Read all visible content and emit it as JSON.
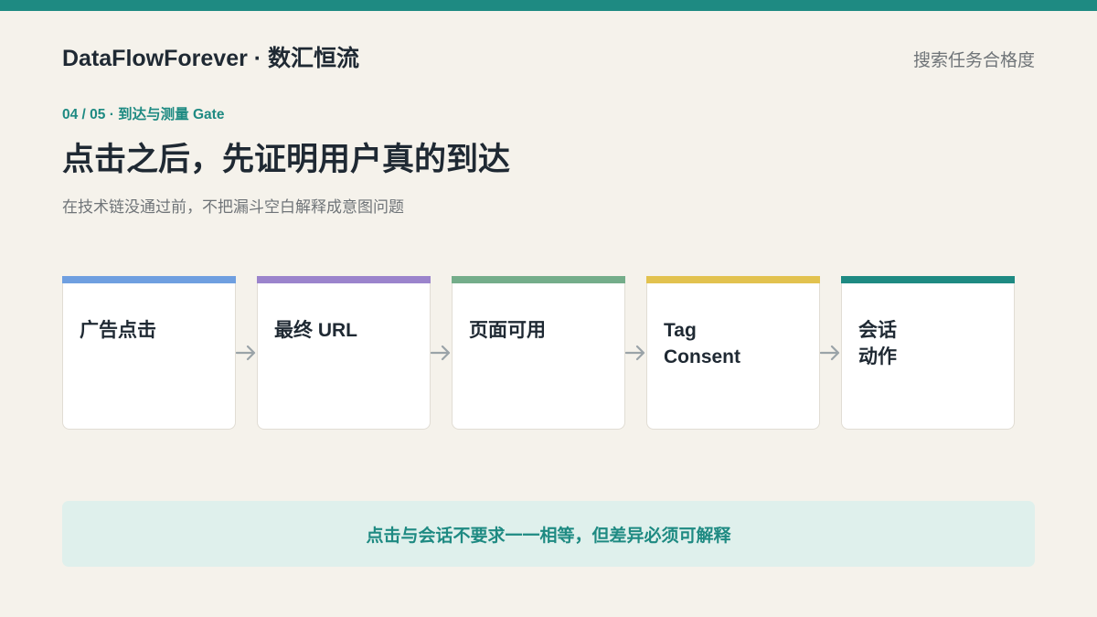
{
  "header": {
    "brand": "DataFlowForever · 数汇恒流",
    "link": "搜索任务合格度"
  },
  "slide": {
    "kicker": "04 / 05 · 到达与测量 Gate",
    "title": "点击之后，先证明用户真的到达",
    "subtitle": "在技术链没通过前，不把漏斗空白解释成意图问题"
  },
  "flow": {
    "steps": [
      {
        "label": "广告点击",
        "accent": "#6f9fe0"
      },
      {
        "label": "最终 URL",
        "accent": "#9b84cc"
      },
      {
        "label": "页面可用",
        "accent": "#74ad8a"
      },
      {
        "label": "Tag\nConsent",
        "accent": "#e2c24f"
      },
      {
        "label": "会话\n动作",
        "accent": "#1e8a82"
      }
    ],
    "arrow_icon": "arrow-right-icon"
  },
  "callout": {
    "text": "点击与会话不要求一一相等，但差异必须可解释"
  },
  "colors": {
    "accent": "#1e8a82",
    "background": "#f5f2eb",
    "callout_bg": "#dff0ec"
  }
}
